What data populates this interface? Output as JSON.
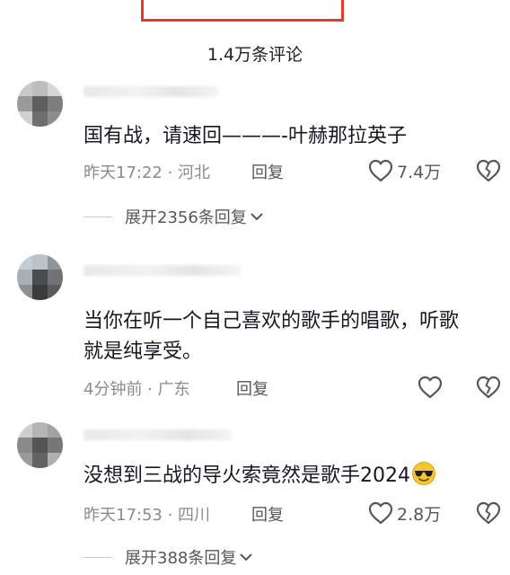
{
  "header": {
    "comment_count": "1.4万条评论"
  },
  "comments": [
    {
      "text": "国有战，请速回———-叶赫那拉英子",
      "time_loc": "昨天17:22 · 河北",
      "reply_label": "回复",
      "likes": "7.4万",
      "replies_label": "展开2356条回复"
    },
    {
      "text": "当你在听一个自己喜欢的歌手的唱歌，听歌就是纯享受。",
      "time_loc": "4分钟前 · 广东",
      "reply_label": "回复",
      "likes": ""
    },
    {
      "text": "没想到三战的导火索竟然是歌手2024",
      "emoji": "sunglasses-emoji",
      "time_loc": "昨天17:53 · 四川",
      "reply_label": "回复",
      "likes": "2.8万",
      "replies_label": "展开388条回复"
    }
  ],
  "icons": {
    "like": "heart-outline-icon",
    "dislike": "broken-heart-icon",
    "expand": "chevron-down-icon"
  },
  "colors": {
    "highlight_box": "#e23b2e",
    "primary_text": "#161823",
    "secondary_text": "#8a8b91"
  }
}
